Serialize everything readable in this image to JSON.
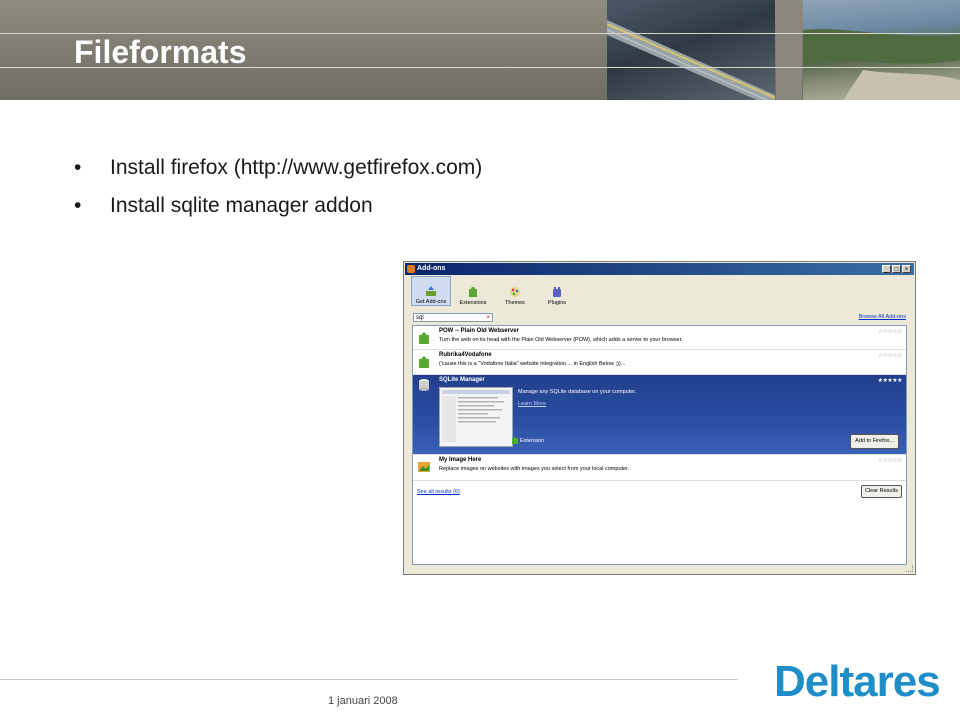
{
  "slide": {
    "title": "Fileformats",
    "bullets": [
      "Install firefox (http://www.getfirefox.com)",
      "Install sqlite manager addon"
    ],
    "footer_date": "1 januari 2008",
    "logo": "Deltares"
  },
  "window": {
    "title": "Add-ons",
    "controls": {
      "minimize": "_",
      "maximize": "□",
      "close": "×"
    },
    "toolbar": [
      {
        "label": "Get Add-ons",
        "icon": "download-addon-icon",
        "active": true
      },
      {
        "label": "Extensions",
        "icon": "puzzle-piece-icon",
        "active": false
      },
      {
        "label": "Themes",
        "icon": "palette-icon",
        "active": false
      },
      {
        "label": "Plugins",
        "icon": "plugin-icon",
        "active": false
      }
    ],
    "search": {
      "value": "sql",
      "clear": "×"
    },
    "browse_all": "Browse All Add-ons",
    "results": [
      {
        "name": "POW -- Plain Old Webserver",
        "desc": "Turn the web on its head with the Plain Old Webserver (POW), which adds a server to your browser.",
        "stars": "☆☆☆☆☆"
      },
      {
        "name": "Rubrika4Vodafone",
        "desc": "('cause this is a \"Vodafone Italia\" website integration.... in English Below ;))...",
        "stars": "☆☆☆☆☆"
      },
      {
        "name": "SQLite Manager",
        "desc": "Manage any SQLite database on your computer.",
        "learn_more": "Learn More",
        "type": "Extension",
        "add_button": "Add to Firefox...",
        "stars": "★★★★★"
      },
      {
        "name": "My Image Here",
        "desc": "Replace images on websites with images you select from your local computer.",
        "stars": "☆☆☆☆☆"
      }
    ],
    "see_all": "See all results (6)",
    "clear_results": "Clear Results"
  },
  "colors": {
    "title_text": "#ffffff",
    "logo": "#1f8ec8",
    "selection": "#2c4fa3",
    "titlebar": "#0a246a"
  }
}
